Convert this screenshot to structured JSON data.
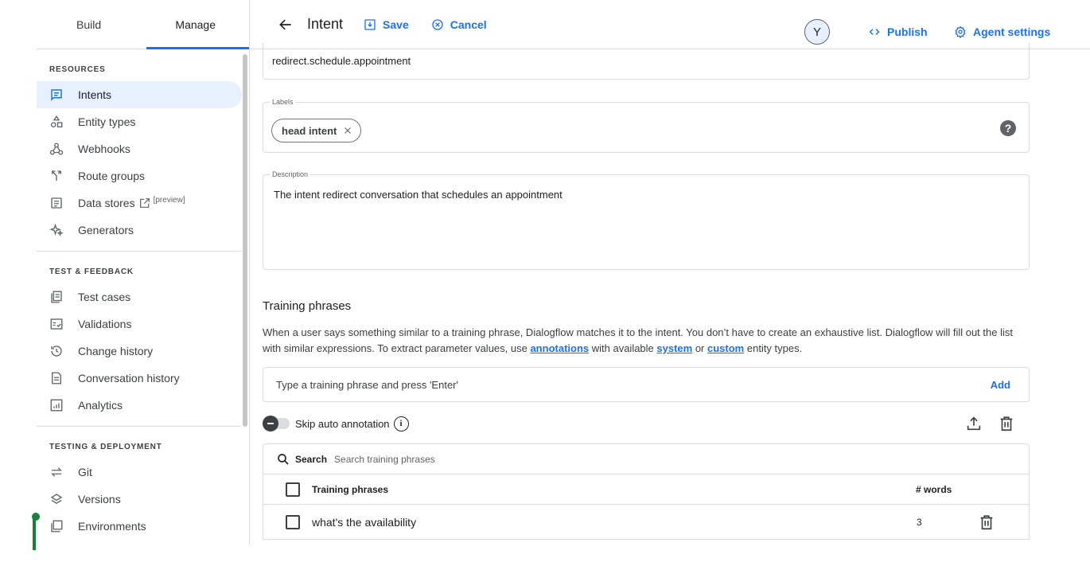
{
  "sidebar": {
    "tabs": [
      {
        "label": "Build"
      },
      {
        "label": "Manage"
      }
    ],
    "sections": [
      {
        "title": "RESOURCES",
        "items": [
          {
            "label": "Intents",
            "icon": "intents-icon"
          },
          {
            "label": "Entity types",
            "icon": "entity-types-icon"
          },
          {
            "label": "Webhooks",
            "icon": "webhooks-icon"
          },
          {
            "label": "Route groups",
            "icon": "route-groups-icon"
          },
          {
            "label": "Data stores",
            "icon": "data-stores-icon",
            "tag": "[preview]"
          },
          {
            "label": "Generators",
            "icon": "generators-icon"
          }
        ]
      },
      {
        "title": "TEST & FEEDBACK",
        "items": [
          {
            "label": "Test cases",
            "icon": "test-cases-icon"
          },
          {
            "label": "Validations",
            "icon": "validations-icon"
          },
          {
            "label": "Change history",
            "icon": "history-icon"
          },
          {
            "label": "Conversation history",
            "icon": "conversation-history-icon"
          },
          {
            "label": "Analytics",
            "icon": "analytics-icon"
          }
        ]
      },
      {
        "title": "TESTING & DEPLOYMENT",
        "items": [
          {
            "label": "Git",
            "icon": "git-icon"
          },
          {
            "label": "Versions",
            "icon": "versions-icon"
          },
          {
            "label": "Environments",
            "icon": "environments-icon"
          }
        ]
      }
    ]
  },
  "topbar": {
    "title": "Intent",
    "save_label": "Save",
    "cancel_label": "Cancel",
    "avatar_letter": "Y",
    "publish_label": "Publish",
    "settings_label": "Agent settings"
  },
  "form": {
    "display_name_value": "redirect.schedule.appointment",
    "labels_label": "Labels",
    "chip_label": "head intent",
    "description_label": "Description",
    "description_value": "The intent redirect conversation that schedules an appointment"
  },
  "training": {
    "title": "Training phrases",
    "desc_part1": "When a user says something similar to a training phrase, Dialogflow matches it to the intent. You don’t have to create an exhaustive list. Dialogflow will fill out the list with similar expressions. To extract parameter values, use ",
    "link_annotations": "annotations",
    "desc_part2": " with available ",
    "link_system": "system",
    "desc_part3": " or ",
    "link_custom": "custom",
    "desc_part4": " entity types.",
    "input_placeholder": "Type a training phrase and press 'Enter'",
    "add_label": "Add",
    "skip_label": "Skip auto annotation",
    "search_label": "Search",
    "search_placeholder": "Search training phrases",
    "col_phrases": "Training phrases",
    "col_words": "# words",
    "rows": [
      {
        "phrase": "what's the availability",
        "words": "3"
      }
    ]
  },
  "colors": {
    "accent": "#1a73e8",
    "active_nav_bg": "#e8f0fe",
    "marker": "#188038"
  }
}
